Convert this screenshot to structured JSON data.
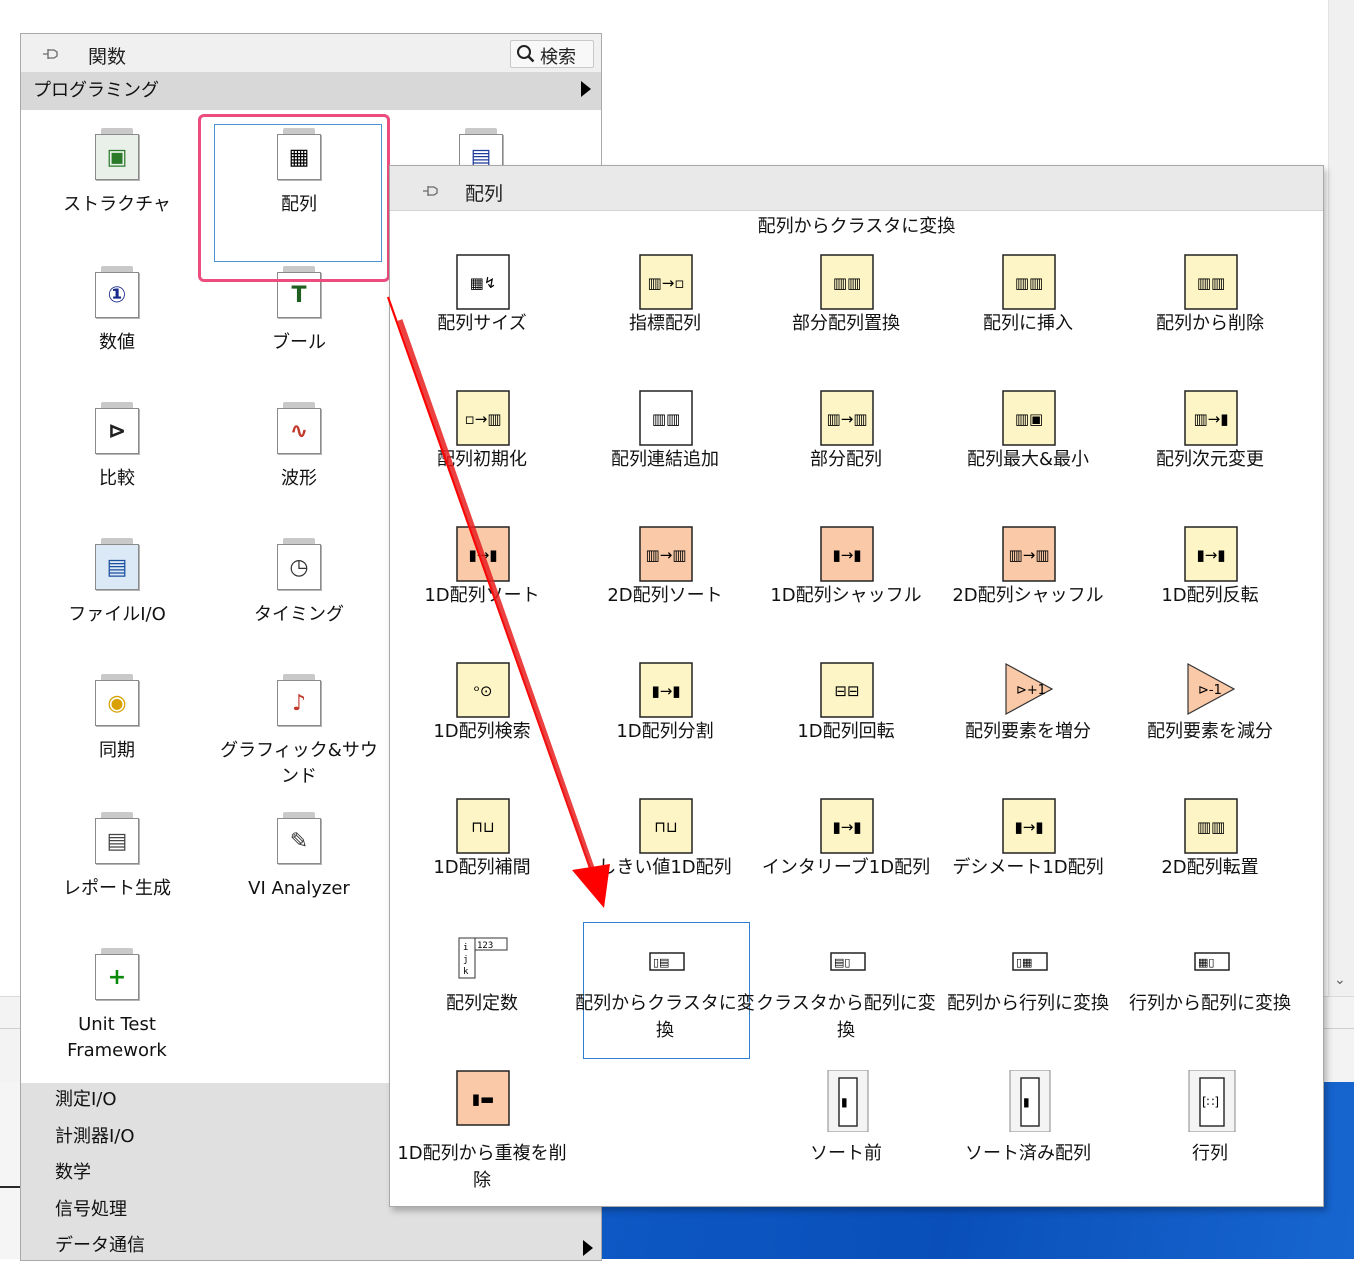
{
  "functions_palette": {
    "title": "関数",
    "search_label": "検索",
    "category": "プログラミング",
    "icons": [
      {
        "label": "ストラクチャ",
        "icon": "structures-icon"
      },
      {
        "label": "配列",
        "icon": "array-icon"
      },
      {
        "label": "",
        "icon": "cluster-class-variant-icon"
      },
      {
        "label": "数値",
        "icon": "numeric-icon"
      },
      {
        "label": "ブール",
        "icon": "boolean-icon"
      },
      {
        "label": "比較",
        "icon": "comparison-icon"
      },
      {
        "label": "波形",
        "icon": "waveform-icon"
      },
      {
        "label": "ファイルI/O",
        "icon": "file-io-icon"
      },
      {
        "label": "タイミング",
        "icon": "timing-icon"
      },
      {
        "label": "同期",
        "icon": "synchronization-icon"
      },
      {
        "label": "グラフィック&サウンド",
        "icon": "graphics-sound-icon"
      },
      {
        "label": "レポート生成",
        "icon": "report-generation-icon"
      },
      {
        "label": "VI Analyzer",
        "icon": "vi-analyzer-icon"
      },
      {
        "label": "Unit Test Framework",
        "icon": "unit-test-framework-icon"
      }
    ],
    "categories": [
      "測定I/O",
      "計測器I/O",
      "数学",
      "信号処理",
      "データ通信"
    ]
  },
  "array_palette": {
    "title": "配列",
    "tooltip": "配列からクラスタに変換",
    "items": [
      {
        "label": "配列サイズ",
        "icon": "array-size-icon",
        "color": "#ffffff"
      },
      {
        "label": "指標配列",
        "icon": "index-array-icon",
        "color": "#fdf5c5"
      },
      {
        "label": "部分配列置換",
        "icon": "replace-array-subset-icon",
        "color": "#fdf5c5"
      },
      {
        "label": "配列に挿入",
        "icon": "insert-into-array-icon",
        "color": "#fdf5c5"
      },
      {
        "label": "配列から削除",
        "icon": "delete-from-array-icon",
        "color": "#fdf5c5"
      },
      {
        "label": "配列初期化",
        "icon": "initialize-array-icon",
        "color": "#fdf5c5"
      },
      {
        "label": "配列連結追加",
        "icon": "build-array-icon",
        "color": "#ffffff"
      },
      {
        "label": "部分配列",
        "icon": "array-subset-icon",
        "color": "#fdf5c5"
      },
      {
        "label": "配列最大&最小",
        "icon": "array-max-min-icon",
        "color": "#fdf5c5"
      },
      {
        "label": "配列次元変更",
        "icon": "reshape-array-icon",
        "color": "#fdf5c5"
      },
      {
        "label": "1D配列ソート",
        "icon": "sort-1d-array-icon",
        "color": "#f9c9a8"
      },
      {
        "label": "2D配列ソート",
        "icon": "sort-2d-array-icon",
        "color": "#f9c9a8"
      },
      {
        "label": "1D配列シャッフル",
        "icon": "shuffle-1d-array-icon",
        "color": "#f9c9a8"
      },
      {
        "label": "2D配列シャッフル",
        "icon": "shuffle-2d-array-icon",
        "color": "#f9c9a8"
      },
      {
        "label": "1D配列反転",
        "icon": "reverse-1d-array-icon",
        "color": "#fdf5c5"
      },
      {
        "label": "1D配列検索",
        "icon": "search-1d-array-icon",
        "color": "#fdf5c5"
      },
      {
        "label": "1D配列分割",
        "icon": "split-1d-array-icon",
        "color": "#fdf5c5"
      },
      {
        "label": "1D配列回転",
        "icon": "rotate-1d-array-icon",
        "color": "#fdf5c5"
      },
      {
        "label": "配列要素を増分",
        "icon": "increment-array-element-icon",
        "color": "#f9c9a8"
      },
      {
        "label": "配列要素を減分",
        "icon": "decrement-array-element-icon",
        "color": "#f9c9a8"
      },
      {
        "label": "1D配列補間",
        "icon": "interpolate-1d-array-icon",
        "color": "#fdf5c5"
      },
      {
        "label": "しきい値1D配列",
        "icon": "threshold-1d-array-icon",
        "color": "#fdf5c5"
      },
      {
        "label": "インタリーブ1D配列",
        "icon": "interleave-1d-arrays-icon",
        "color": "#fdf5c5"
      },
      {
        "label": "デシメート1D配列",
        "icon": "decimate-1d-array-icon",
        "color": "#fdf5c5"
      },
      {
        "label": "2D配列転置",
        "icon": "transpose-2d-array-icon",
        "color": "#fdf5c5"
      },
      {
        "label": "配列定数",
        "icon": "array-constant-icon",
        "color": "#ffffff"
      },
      {
        "label": "配列からクラスタに変換",
        "icon": "array-to-cluster-icon",
        "color": "#fdf5c5"
      },
      {
        "label": "クラスタから配列に変換",
        "icon": "cluster-to-array-icon",
        "color": "#fdf5c5"
      },
      {
        "label": "配列から行列に変換",
        "icon": "array-to-matrix-icon",
        "color": "#fdf5c5"
      },
      {
        "label": "行列から配列に変換",
        "icon": "matrix-to-array-icon",
        "color": "#fdf5c5"
      },
      {
        "label": "1D配列から重複を削除",
        "icon": "remove-duplicates-icon",
        "color": "#f9c9a8"
      },
      {
        "label": "ソート前",
        "icon": "sorted-array-unsorted-icon",
        "color": "#ffffff"
      },
      {
        "label": "ソート済み配列",
        "icon": "sorted-array-icon",
        "color": "#ffffff"
      },
      {
        "label": "行列",
        "icon": "matrix-icon",
        "color": "#ffffff"
      }
    ]
  },
  "colors": {
    "selection_highlight": "#ec4c7e",
    "arrow": "#ff0000",
    "hover_border": "#2f7fd0",
    "desktop": "#0d58c4"
  }
}
